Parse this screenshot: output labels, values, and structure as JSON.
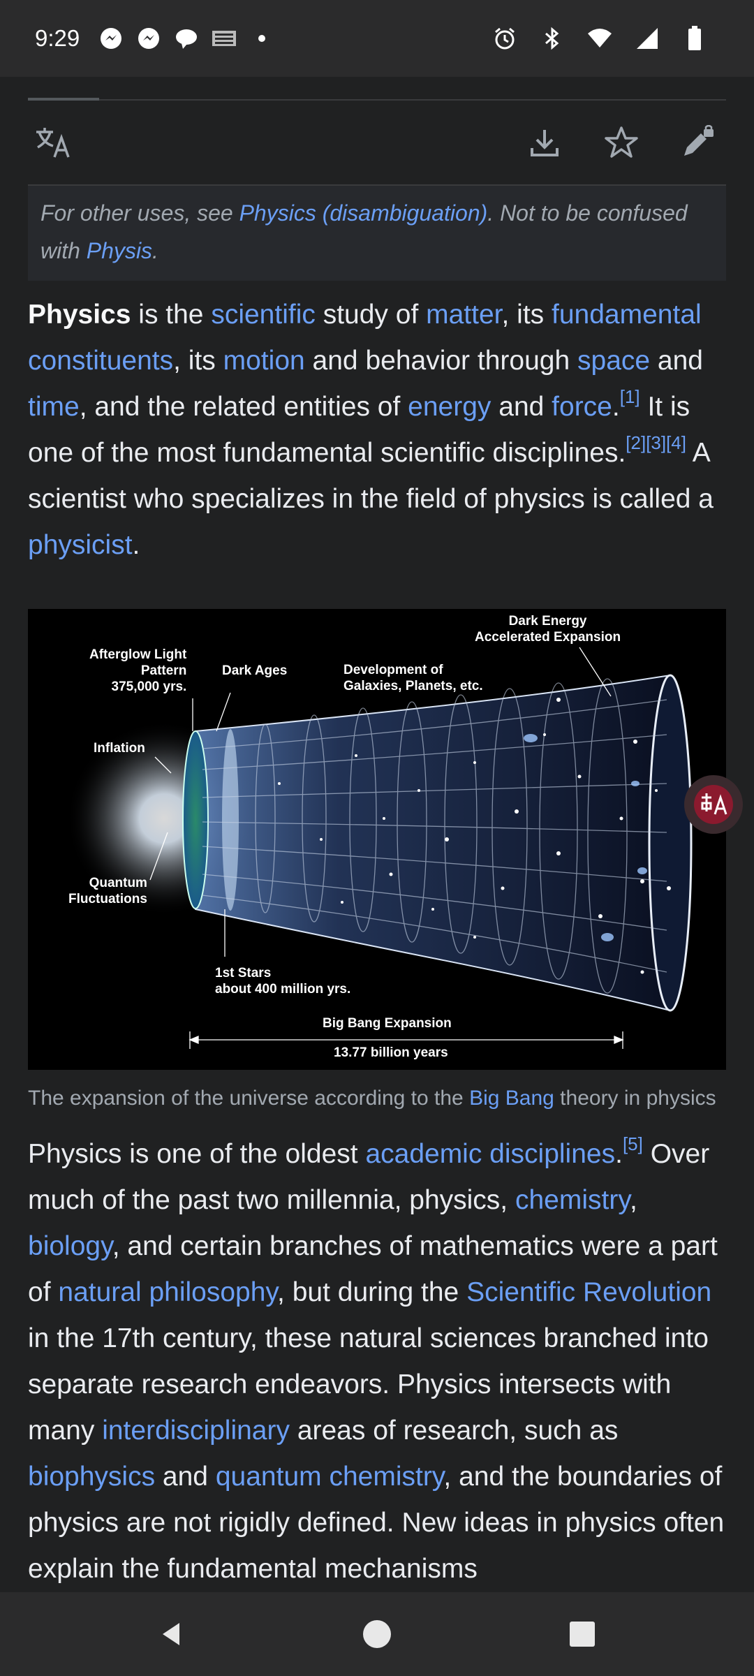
{
  "status_bar": {
    "time": "9:29",
    "left_icons": [
      "messenger-icon",
      "messenger-icon",
      "chat-bubble-icon",
      "news-icon",
      "dot-icon"
    ],
    "right_icons": [
      "alarm-icon",
      "bluetooth-icon",
      "wifi-icon",
      "signal-icon",
      "battery-icon"
    ]
  },
  "toolbar": {
    "icons": [
      "translate-icon",
      "download-icon",
      "star-icon",
      "edit-lock-icon"
    ]
  },
  "hatnote": {
    "prefix": "For other uses, see ",
    "link1": "Physics (disambiguation)",
    "middle": ". Not to be confused with ",
    "link2": "Physis",
    "suffix": "."
  },
  "lead": {
    "b_title": "Physics",
    "t1": " is the ",
    "l_scientific": "scientific",
    "t2": " study of ",
    "l_matter": "matter",
    "t3": ", its ",
    "l_fundamental": "fundamental constituents",
    "t4": ", its ",
    "l_motion": "motion",
    "t5": " and behavior through ",
    "l_space": "space",
    "t6": " and ",
    "l_time": "time",
    "t7": ", and the related entities of ",
    "l_energy": "energy",
    "t8": " and ",
    "l_force": "force",
    "t9": ".",
    "ref1": "[1]",
    "t10": " It is one of the most fundamental scientific disciplines.",
    "ref2": "[2][3][4]",
    "t11": " A scientist who specializes in the field of physics is called a ",
    "l_physicist": "physicist",
    "t12": "."
  },
  "figure": {
    "labels": {
      "dark_energy": "Dark Energy\nAccelerated Expansion",
      "afterglow": "Afterglow Light\nPattern\n375,000 yrs.",
      "dark_ages": "Dark Ages",
      "development": "Development of\nGalaxies, Planets, etc.",
      "inflation": "Inflation",
      "quantum": "Quantum\nFluctuations",
      "first_stars": "1st Stars\nabout 400 million yrs.",
      "big_bang": "Big Bang Expansion",
      "years": "13.77 billion years"
    }
  },
  "caption": {
    "t1": "The expansion of the universe according to the ",
    "link": "Big Bang",
    "t2": " theory in physics"
  },
  "para2": {
    "t1": "Physics is one of the oldest ",
    "l_academic": "academic disciplines",
    "t2": ".",
    "ref5": "[5]",
    "t3": " Over much of the past two millennia, physics, ",
    "l_chemistry": "chemistry",
    "t4": ", ",
    "l_biology": "biology",
    "t5": ", and certain branches of mathematics were a part of ",
    "l_natphil": "natural philosophy",
    "t6": ", but during the ",
    "l_scirev": "Scientific Revolution",
    "t7": " in the 17th century, these natural sciences branched into separate research endeavors. Physics intersects with many ",
    "l_interdisc": "interdisciplinary",
    "t8": " areas of research, such as ",
    "l_biophysics": "biophysics",
    "t9": " and ",
    "l_quantchem": "quantum chemistry",
    "t10": ", and the boundaries of physics are not rigidly defined. New ideas in physics often explain the fundamental mechanisms"
  },
  "nav_bar": {
    "icons": [
      "back-icon",
      "home-icon",
      "recents-icon"
    ]
  },
  "colors": {
    "background": "#202122",
    "link": "#6b9ff5",
    "text": "#eaecf0",
    "muted": "#a2a9b1"
  }
}
